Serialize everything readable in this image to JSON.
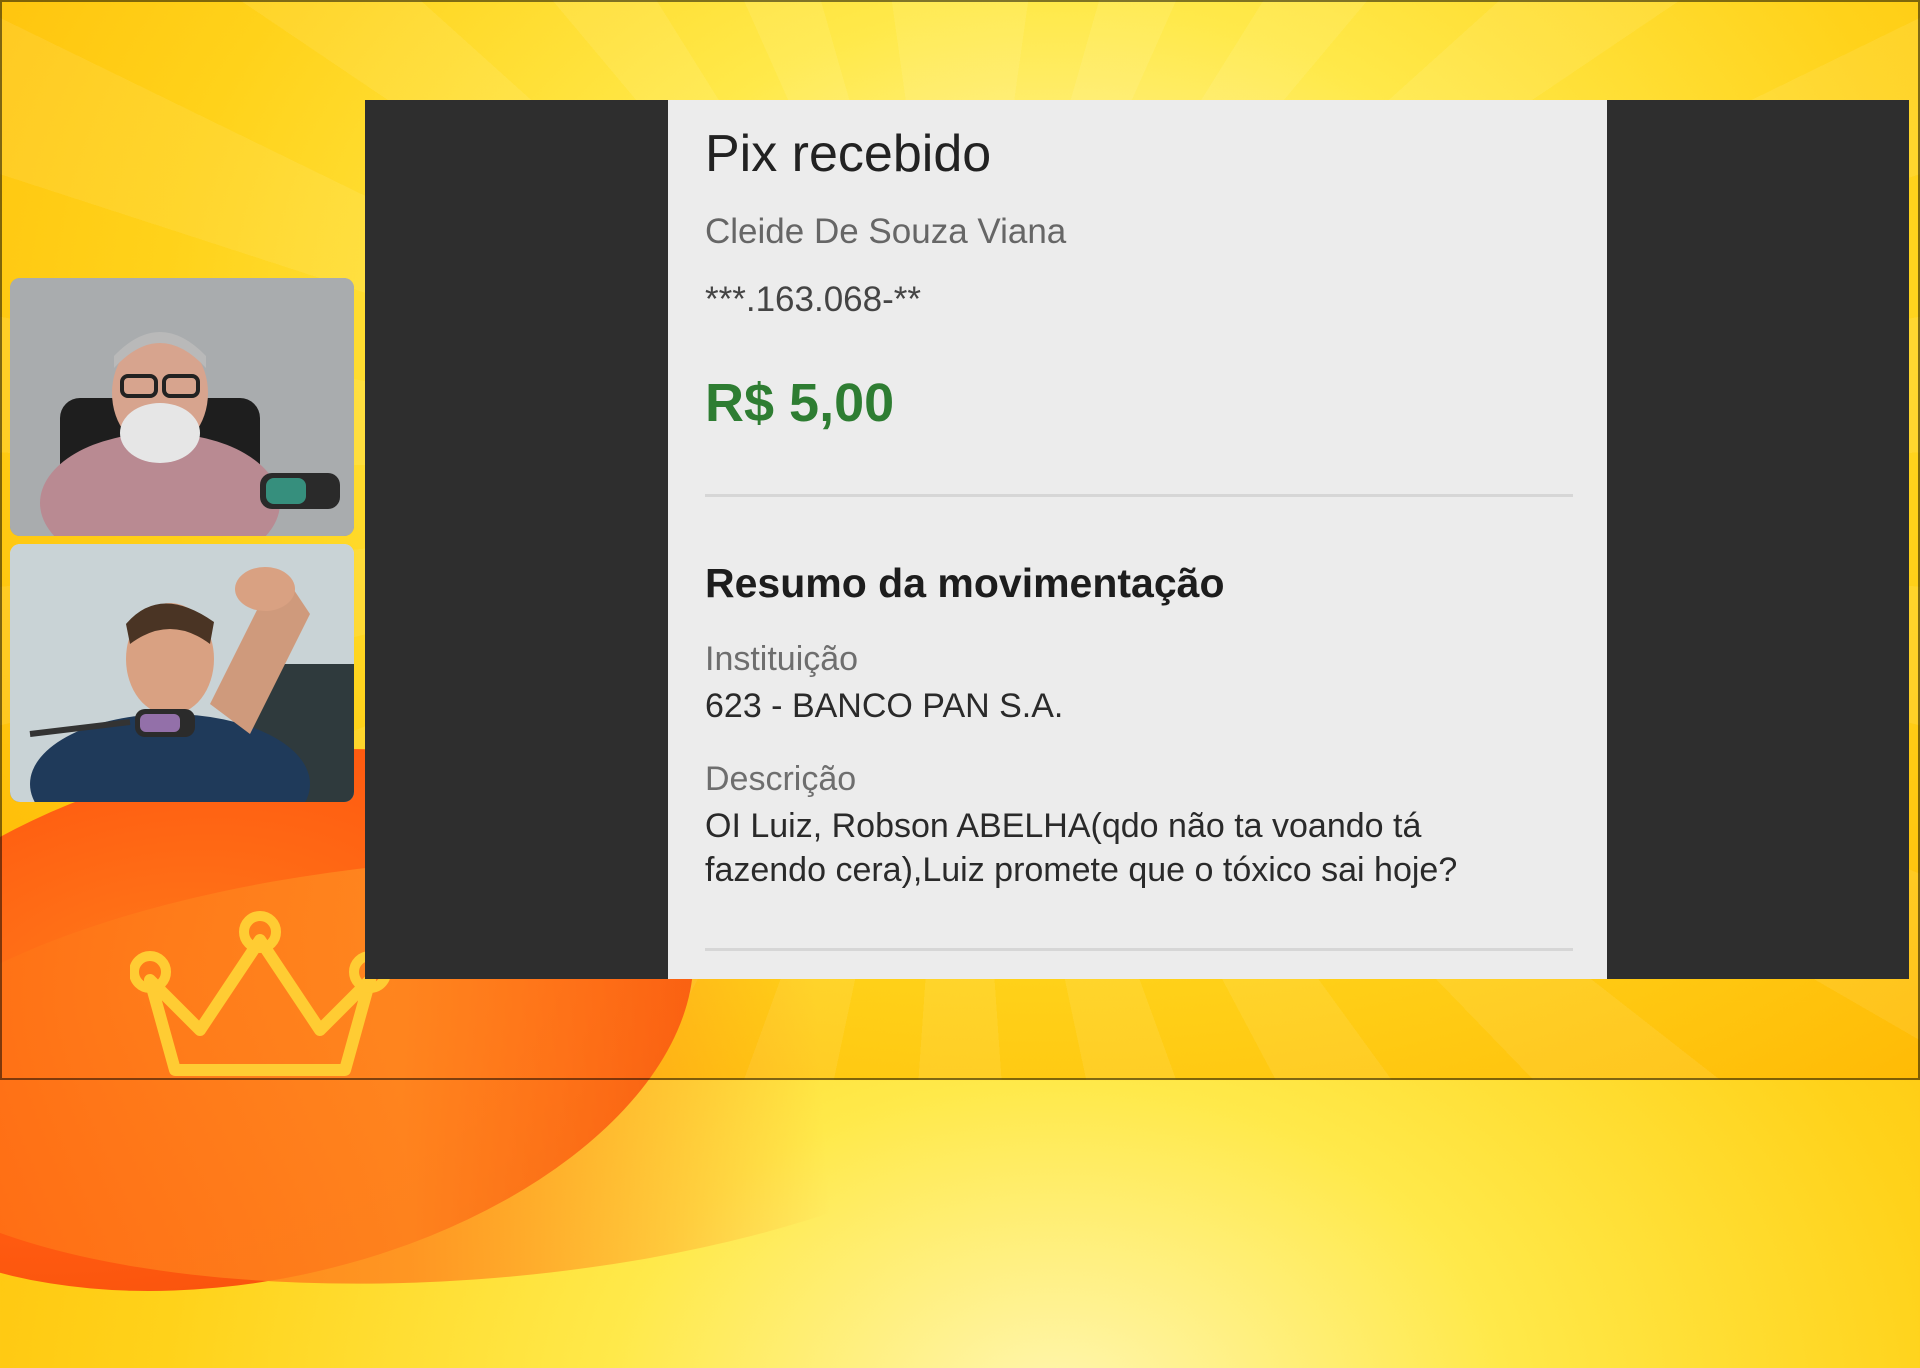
{
  "receipt": {
    "title": "Pix recebido",
    "payer_name": "Cleide De Souza Viana",
    "payer_document": "***.163.068-**",
    "amount": "R$ 5,00",
    "summary_title": "Resumo da movimentação",
    "institution_label": "Instituição",
    "institution_value": "623 - BANCO PAN S.A.",
    "description_label": "Descrição",
    "description_line_1": "OI Luiz, Robson ABELHA(qdo não ta voando tá",
    "description_line_2": "fazendo cera),Luiz promete que o tóxico sai hoje?"
  },
  "colors": {
    "amount_green": "#2e7d32",
    "background_yellow": "#ffd21a",
    "accent_orange": "#ff5a10",
    "screen_dark": "#2e2e2e",
    "receipt_bg": "#ececec"
  }
}
